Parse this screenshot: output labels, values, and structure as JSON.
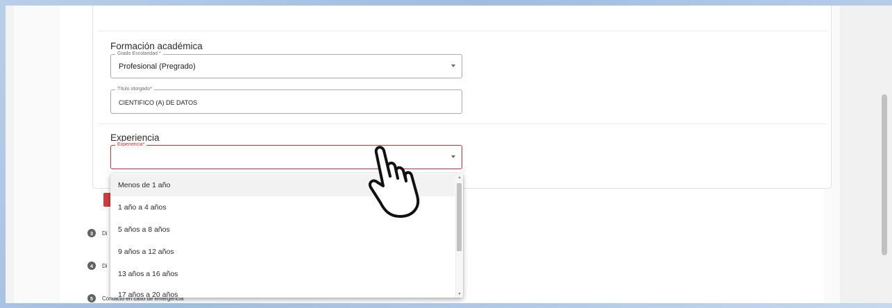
{
  "formacion": {
    "title": "Formación académica",
    "grado": {
      "label": "Grado Escolaridad *",
      "value": "Profesional (Pregrado)"
    },
    "titulo": {
      "label": "Título otorgado*",
      "value": "CIENTIFICO (A) DE DATOS"
    }
  },
  "experiencia": {
    "title": "Experiencia",
    "field": {
      "label": "Experiencia*",
      "value": ""
    },
    "options": [
      "Menos de 1 año",
      "1 año a 4 años",
      "5 años a 8 años",
      "9 años a 12 años",
      "13 años a 16 años",
      "17 años a 20 años"
    ]
  },
  "steps": [
    {
      "num": "3",
      "label": "Di"
    },
    {
      "num": "4",
      "label": "Di"
    },
    {
      "num": "5",
      "label": "Contacto en caso de emergencia"
    }
  ],
  "colors": {
    "error": "#d32f2f",
    "accent_button": "#d93a3a"
  },
  "icons": {
    "cursor": "pointer-hand-icon",
    "dropdown": "caret-down-icon"
  }
}
